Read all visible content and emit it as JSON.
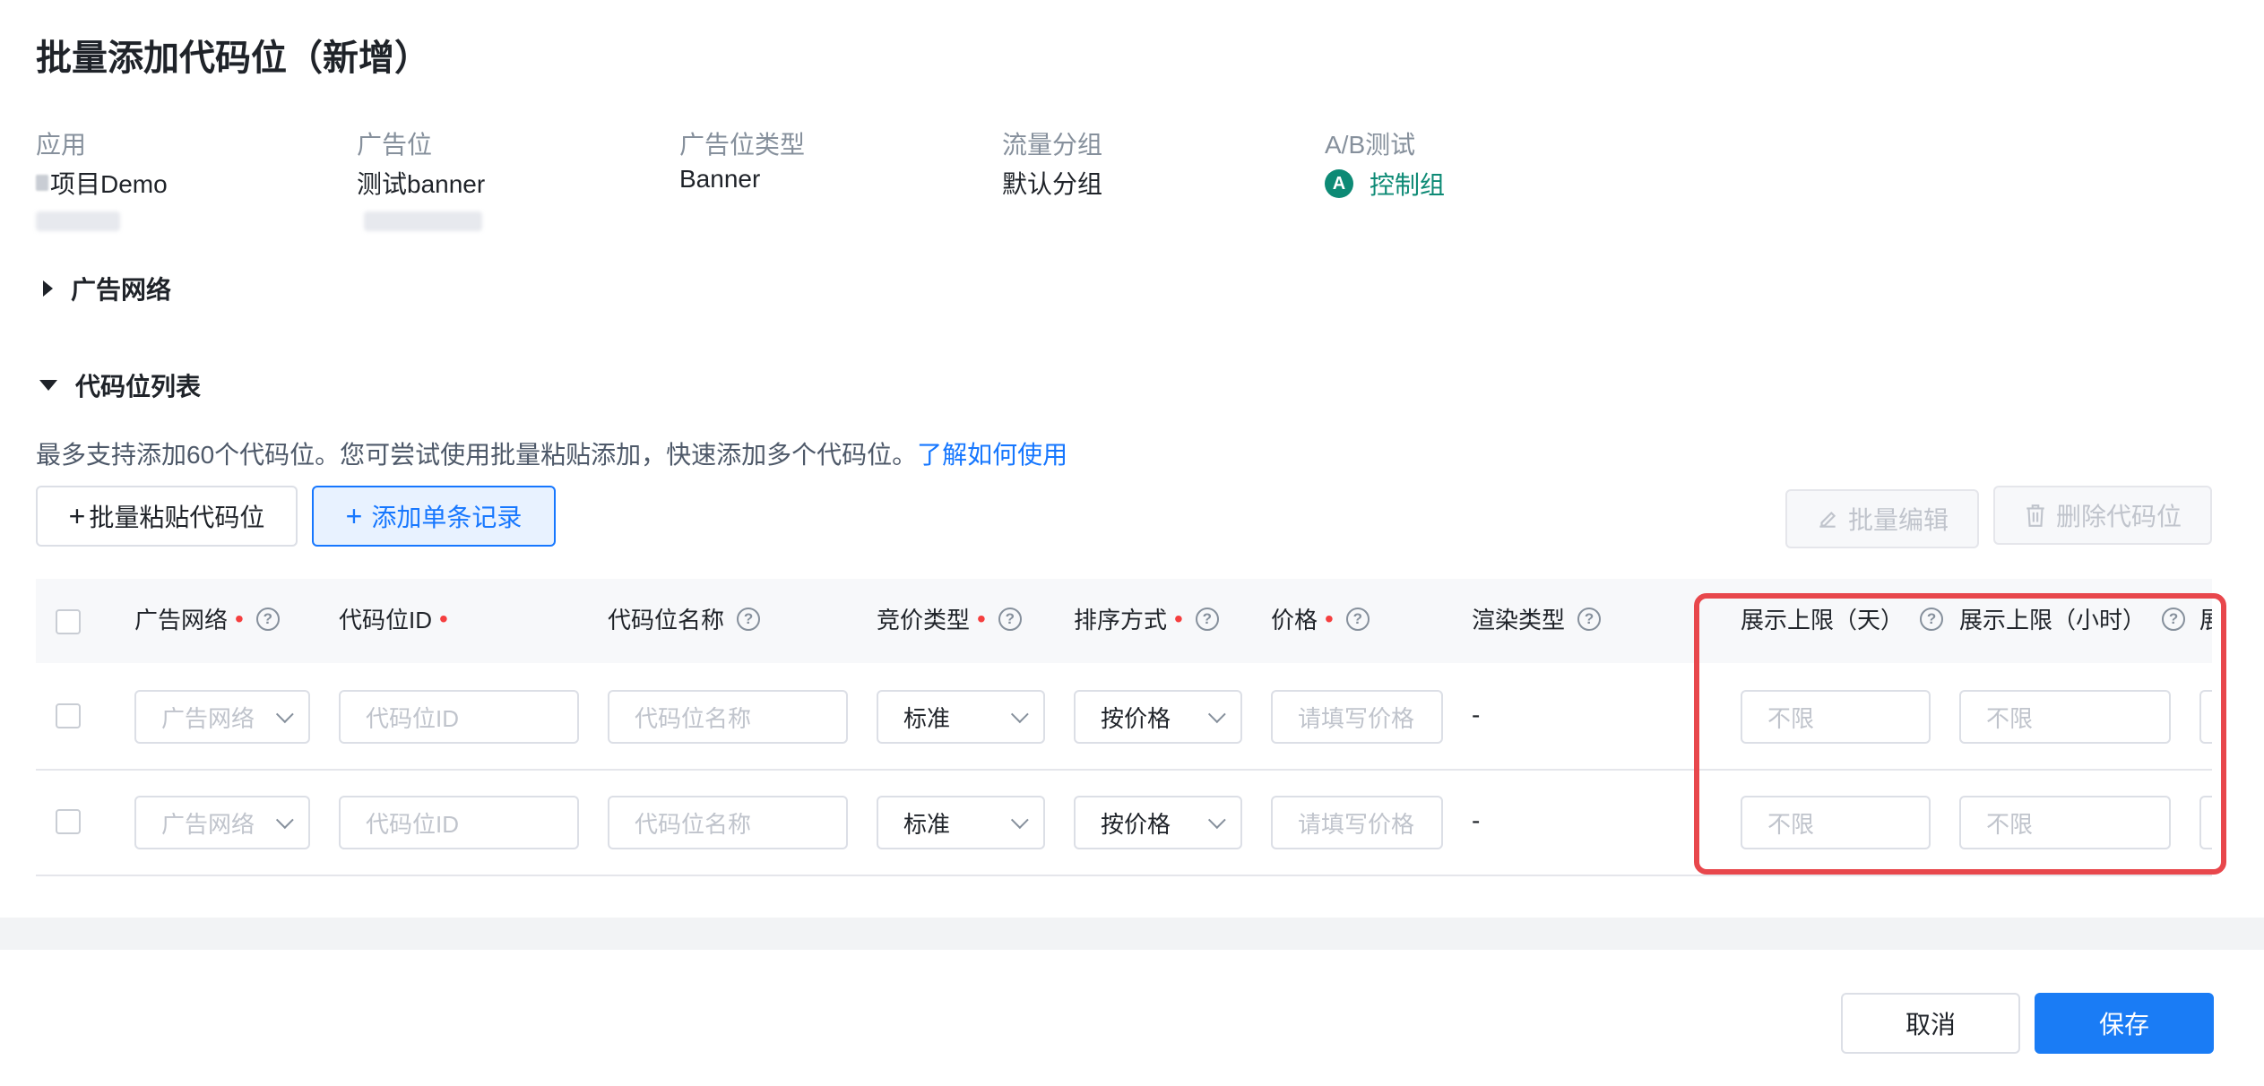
{
  "page_title": "批量添加代码位（新增）",
  "info": {
    "app": {
      "label": "应用",
      "value": "项目Demo"
    },
    "placement": {
      "label": "广告位",
      "value": "测试banner"
    },
    "placement_type": {
      "label": "广告位类型",
      "value": "Banner"
    },
    "traffic_group": {
      "label": "流量分组",
      "value": "默认分组"
    },
    "ab_test": {
      "label": "A/B测试",
      "badge": "A",
      "value": "控制组"
    }
  },
  "sections": {
    "ad_network": "广告网络",
    "code_list": "代码位列表"
  },
  "hint": {
    "text": "最多支持添加60个代码位。您可尝试使用批量粘贴添加，快速添加多个代码位。",
    "link": "了解如何使用"
  },
  "toolbar": {
    "batch_paste": "批量粘贴代码位",
    "add_single": "添加单条记录",
    "batch_edit": "批量编辑",
    "delete": "删除代码位"
  },
  "table": {
    "columns": {
      "ad_network": "广告网络",
      "code_id": "代码位ID",
      "code_name": "代码位名称",
      "bid_type": "竞价类型",
      "sort_method": "排序方式",
      "price": "价格",
      "render_type": "渲染类型",
      "limit_day": "展示上限（天）",
      "limit_hour": "展示上限（小时）",
      "truncated": "展"
    },
    "placeholders": {
      "ad_network": "广告网络",
      "code_id": "代码位ID",
      "code_name": "代码位名称",
      "price": "请填写价格",
      "limit": "不限"
    },
    "rows": [
      {
        "bid_type": "标准",
        "sort_method": "按价格",
        "render_type": "-"
      },
      {
        "bid_type": "标准",
        "sort_method": "按价格",
        "render_type": "-"
      }
    ]
  },
  "footer": {
    "cancel": "取消",
    "save": "保存"
  },
  "colors": {
    "primary": "#1a7cf5",
    "ab_green": "#0d8a75",
    "highlight_red": "#e8474c",
    "required_red": "#f53f3f"
  }
}
